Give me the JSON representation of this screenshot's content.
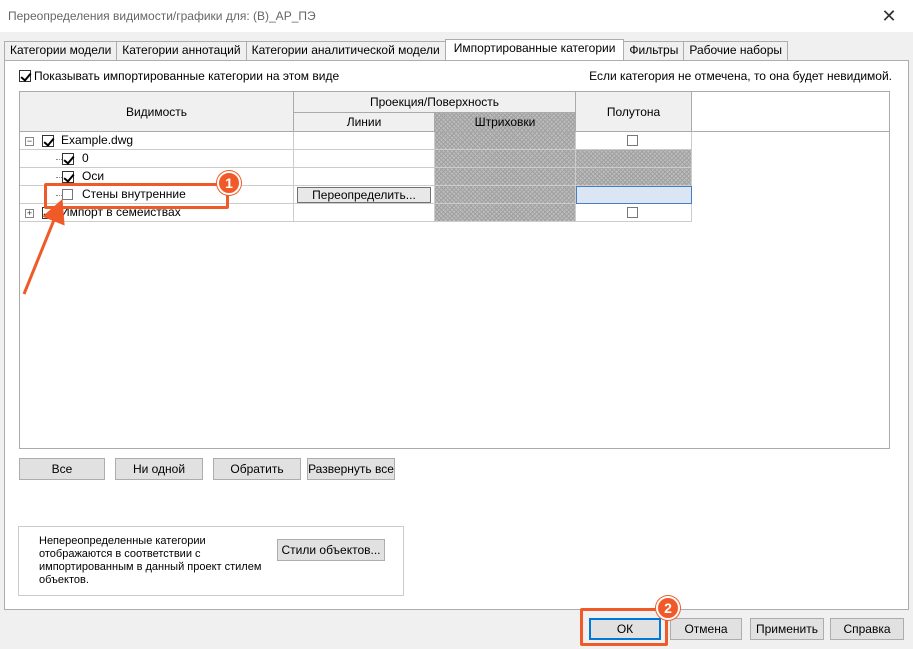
{
  "window": {
    "title": "Переопределения видимости/графики для: (В)_АР_ПЭ"
  },
  "tabs": [
    {
      "label": "Категории модели",
      "active": false
    },
    {
      "label": "Категории аннотаций",
      "active": false
    },
    {
      "label": "Категории аналитической модели",
      "active": false
    },
    {
      "label": "Импортированные категории",
      "active": true
    },
    {
      "label": "Фильтры",
      "active": false
    },
    {
      "label": "Рабочие наборы",
      "active": false
    }
  ],
  "show_imported": {
    "label": "Показывать импортированные категории на этом виде",
    "checked": true
  },
  "hint": "Если категория не отмечена, то она будет невидимой.",
  "grid": {
    "headers": {
      "visibility": "Видимость",
      "projection": "Проекция/Поверхность",
      "lines": "Линии",
      "hatching": "Штриховки",
      "halftone": "Полутона"
    },
    "rows": [
      {
        "label": "Example.dwg",
        "checked": true
      },
      {
        "label": "0",
        "checked": true
      },
      {
        "label": "Оси",
        "checked": true
      },
      {
        "label": "Стены внутренние",
        "checked": false,
        "override_label": "Переопределить..."
      },
      {
        "label": "Импорт в семействах",
        "checked": true
      }
    ]
  },
  "buttons": {
    "all": "Все",
    "none": "Ни одной",
    "invert": "Обратить",
    "expand_all": "Развернуть все",
    "object_styles": "Стили объектов...",
    "ok": "ОК",
    "cancel": "Отмена",
    "apply": "Применить",
    "help": "Справка"
  },
  "info_text": "Непереопределенные категории отображаются в соответствии с импортированным в данный проект стилем объектов.",
  "annotations": {
    "badge1": "1",
    "badge2": "2",
    "accent_color": "#f05a28"
  }
}
